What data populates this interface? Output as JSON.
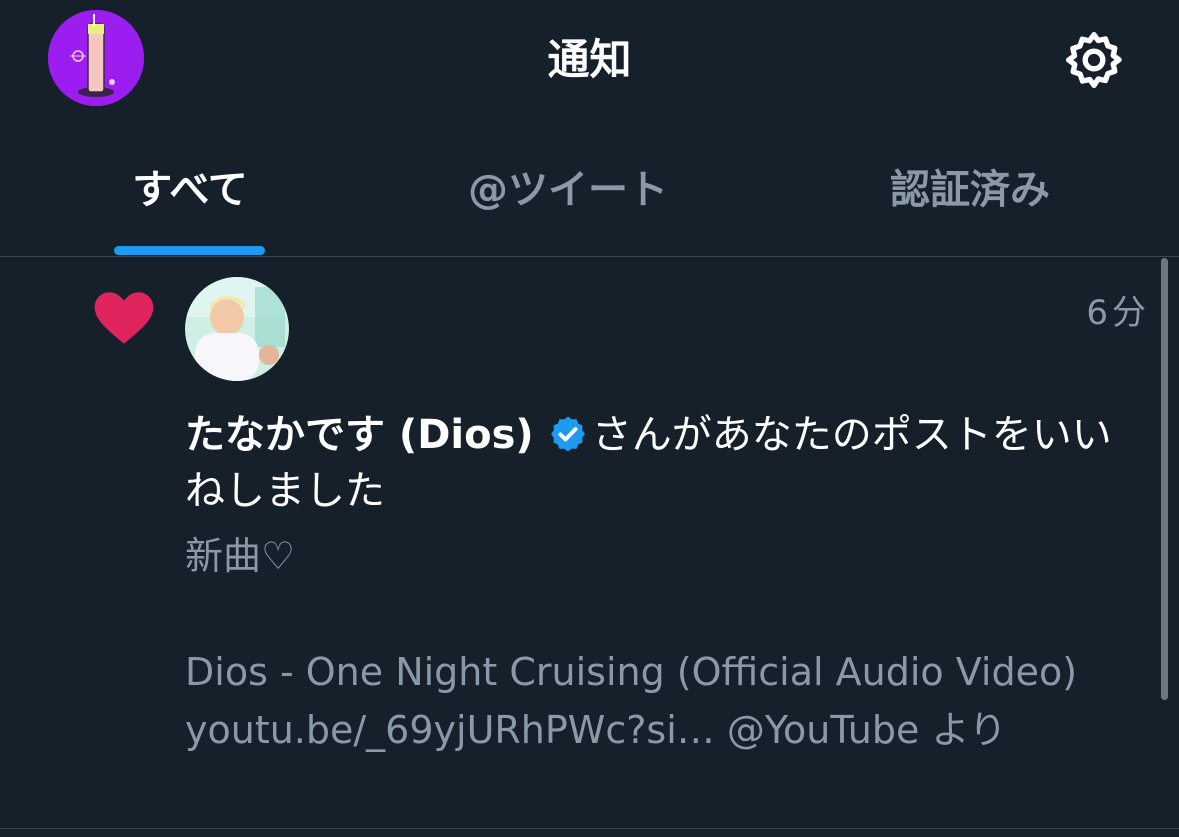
{
  "header": {
    "title": "通知"
  },
  "tabs": [
    {
      "label": "すべて",
      "active": true
    },
    {
      "label": "@ツイート",
      "active": false
    },
    {
      "label": "認証済み",
      "active": false
    }
  ],
  "notification": {
    "type_icon": "heart-icon",
    "time": "6分",
    "user_name": "たなかです (Dios)",
    "verified": true,
    "action_text": "さんがあなたのポストをいいねしました",
    "tweet_text": "新曲♡\n\nDios - One Night Cruising (Official Audio Video) youtu.be/_69yjURhPWc?si… @YouTube より"
  },
  "colors": {
    "background": "#15202b",
    "accent": "#1d9bf0",
    "like": "#e0245e",
    "secondary_text": "#8b98a5",
    "profile_avatar": "#9b1df0"
  }
}
